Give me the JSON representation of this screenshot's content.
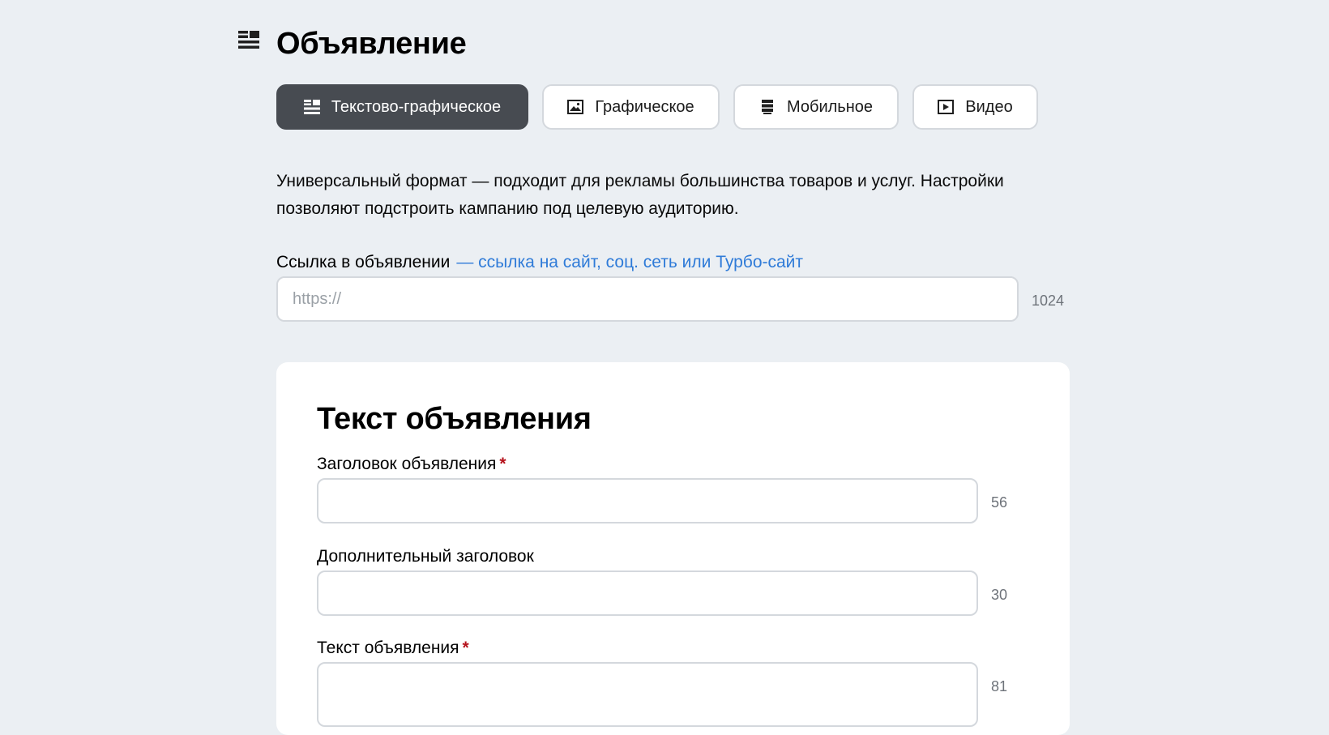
{
  "page": {
    "title": "Объявление",
    "icon": "text-list-icon"
  },
  "format_tabs": [
    {
      "label": "Текстово-графическое",
      "icon": "text-list-icon",
      "active": true
    },
    {
      "label": "Графическое",
      "icon": "image-icon",
      "active": false
    },
    {
      "label": "Мобильное",
      "icon": "mobile-icon",
      "active": false
    },
    {
      "label": "Видео",
      "icon": "video-icon",
      "active": false
    }
  ],
  "description": "Универсальный формат — подходит для рекламы большинства товаров и услуг. Настройки позволяют подстроить кампанию под целевую аудиторию.",
  "ad_link": {
    "label": "Ссылка в объявлении",
    "hint": "— ссылка на сайт, соц. сеть или Турбо-сайт",
    "placeholder": "https://",
    "value": "",
    "counter": "1024"
  },
  "ad_text_section": {
    "title": "Текст объявления",
    "fields": [
      {
        "label": "Заголовок объявления",
        "required_mark": "*",
        "value": "",
        "counter": "56"
      },
      {
        "label": "Дополнительный заголовок",
        "value": "",
        "counter": "30"
      },
      {
        "label": "Текст объявления",
        "required_mark": "*",
        "value": "",
        "counter": "81"
      }
    ]
  },
  "colors": {
    "background": "#ebeff3",
    "active_tab": "#474b51",
    "link": "#2f7bd8",
    "required": "#b5121b"
  }
}
